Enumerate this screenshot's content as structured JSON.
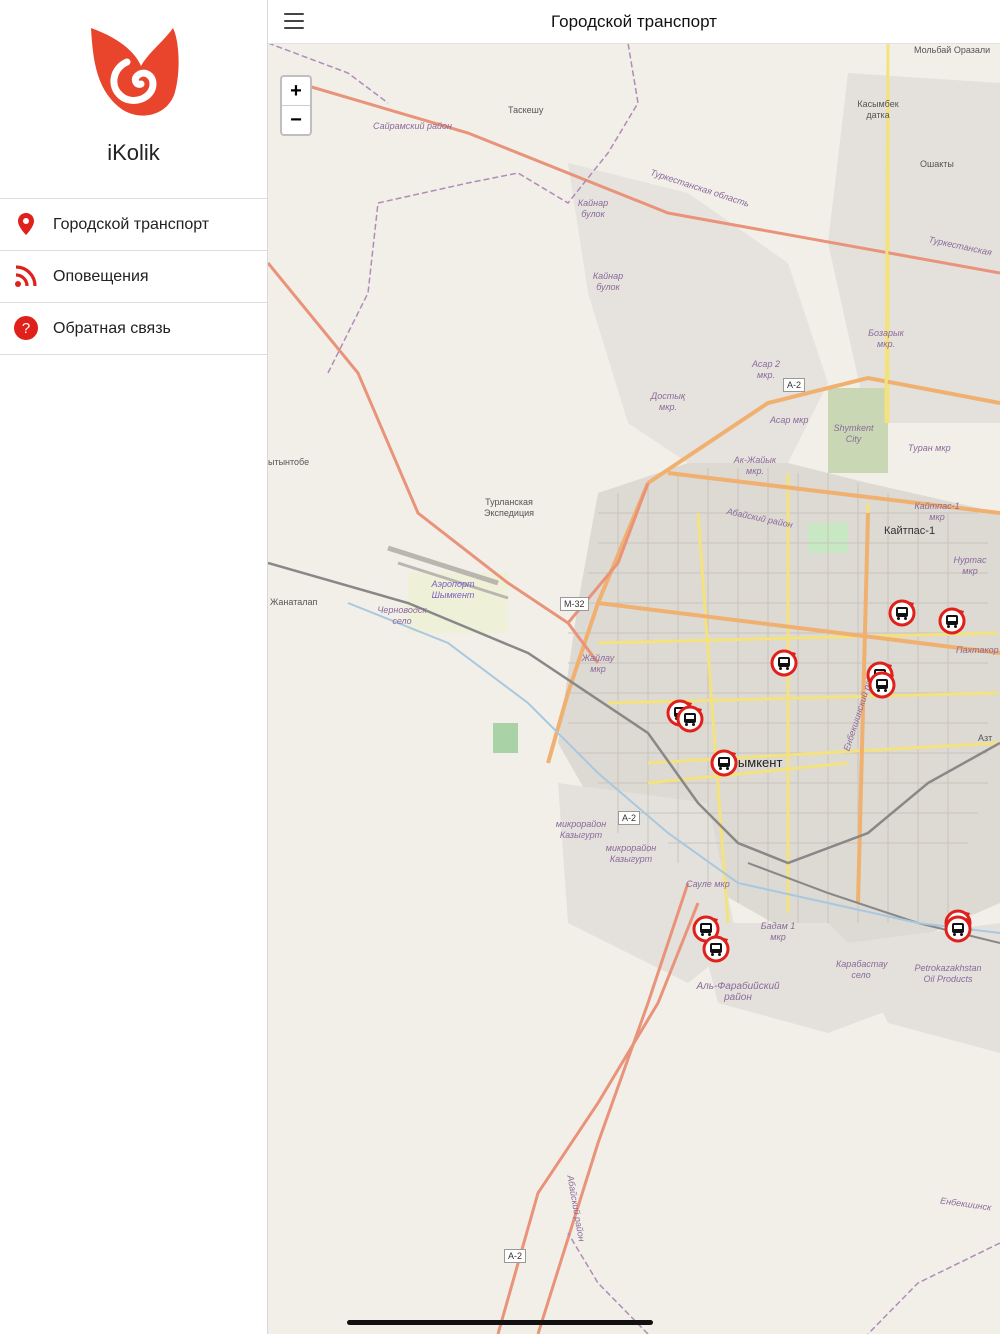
{
  "app": {
    "name": "iKolik",
    "brand_color": "#e8452c"
  },
  "sidebar": {
    "items": [
      {
        "label": "Городской транспорт",
        "icon": "map-pin-icon",
        "color": "#e0201b"
      },
      {
        "label": "Оповещения",
        "icon": "rss-icon",
        "color": "#e0201b"
      },
      {
        "label": "Обратная связь",
        "icon": "question-icon",
        "color": "#e0201b"
      }
    ]
  },
  "header": {
    "title": "Городской транспорт",
    "menu_icon": "hamburger-icon"
  },
  "map": {
    "zoom_in": "+",
    "zoom_out": "−",
    "labels": {
      "molyba": "Мольбай Оразали",
      "tasheshu": "Таскешу",
      "sairam": "Сайрамский район",
      "kasymbek": "Касымбек датка",
      "oshakty": "Ошакты",
      "turk_obl": "Туркестанская область",
      "turk_road": "Туркестанская",
      "kainar1": "Кайнар булок",
      "kainar2": "Кайнар булок",
      "bozaryk": "Бозарык мкр.",
      "asar": "Асар 2 мкр.",
      "asar_mkr": "Асар мкр",
      "dostyk": "Достық мкр.",
      "shymkent_city": "Shymkent City",
      "ak_zhaiyk": "Ак-Жайык мкр.",
      "turan": "Туран мкр",
      "kaitpas1": "Кайтпас-1 мкр",
      "kaitpas": "Кайтпас-1",
      "abai": "Абайский район",
      "nurtas": "Нуртас мкр",
      "kyntobe": "ытынтобе",
      "turlanskaya": "Турланская Экспедиция",
      "airport": "Аэропорт Шымкент",
      "zhanatalap": "Жанаталап",
      "chernovodsk": "Черноводск село",
      "zhailau": "Жайлау мкр",
      "shymkent": "Шымкент",
      "pakhtakor": "Пахтакор",
      "kazygurt1": "микрорайон Казыгурт",
      "kazygurt2": "микрорайон Казыгурт",
      "saule": "Сауле мкр",
      "badam": "Бадам 1 мкр",
      "karabastau": "Карабастау село",
      "petrokaz": "Petrokazakhstan Oil Products",
      "alfarabi": "Аль-Фарабийский район",
      "abaisky": "Абайский район",
      "enbekshi": "Енбекшинский район",
      "enbekshin": "Енбекшинск",
      "aztu": "Азт"
    },
    "shields": {
      "a2_top": "A-2",
      "m32": "M-32",
      "a2_mid": "A-2",
      "a2_bot": "A-2"
    },
    "marker_icon": "bus-icon",
    "marker_color": "#e0201b"
  }
}
